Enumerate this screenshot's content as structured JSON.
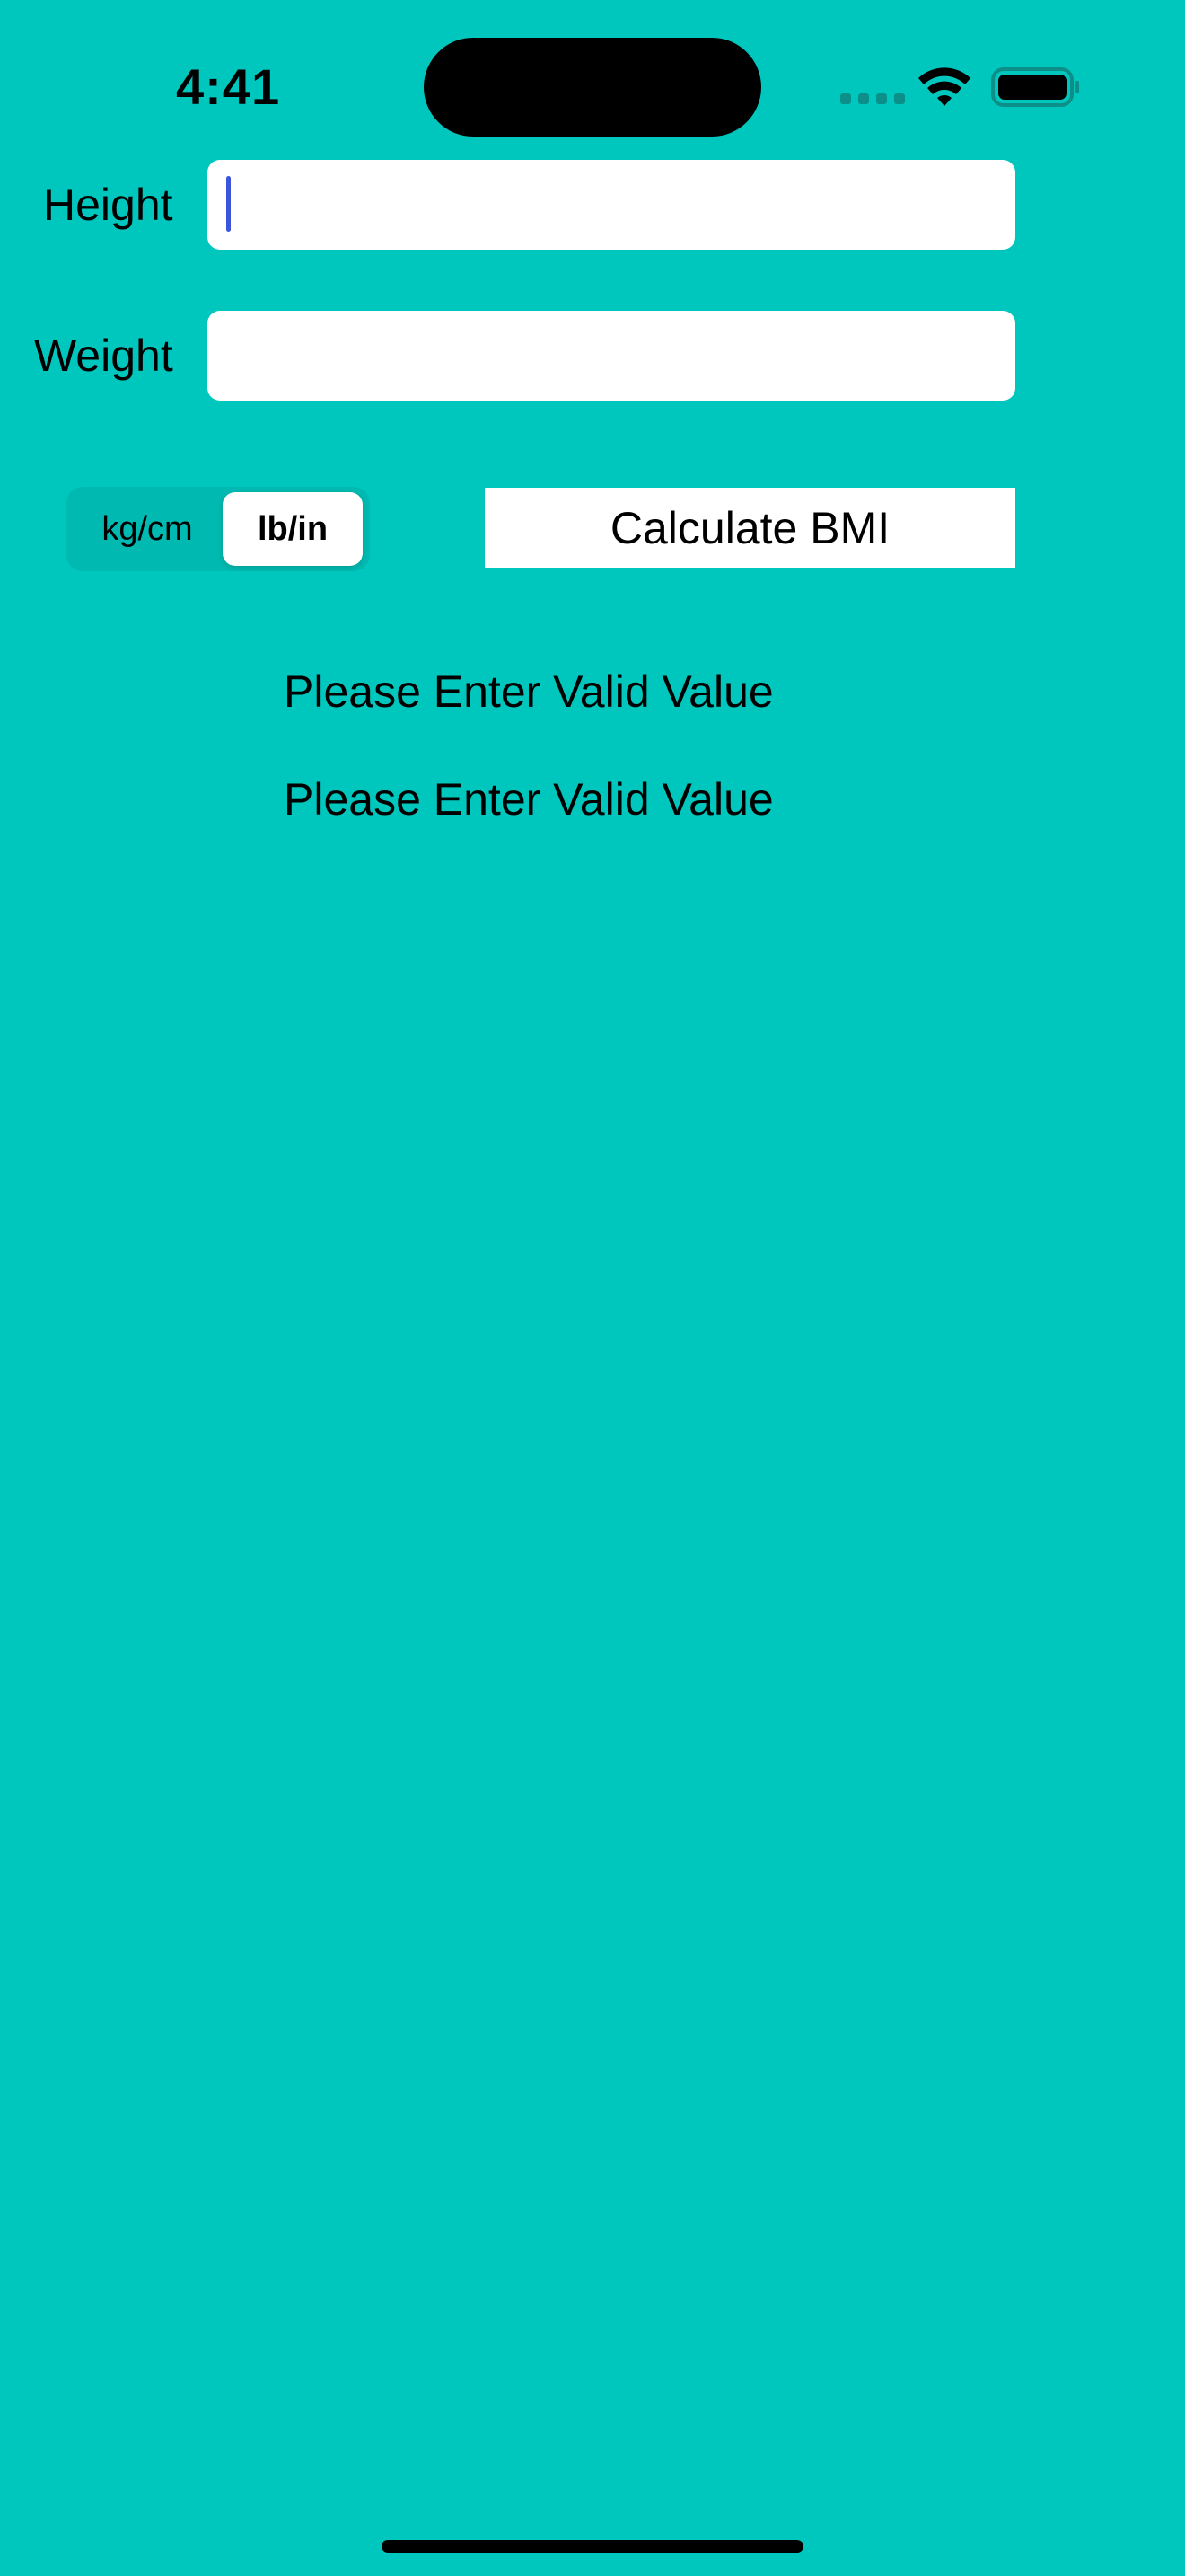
{
  "status_bar": {
    "time": "4:41"
  },
  "form": {
    "height_label": "Height",
    "height_value": "",
    "weight_label": "Weight",
    "weight_value": ""
  },
  "units": {
    "options": [
      "kg/cm",
      "lb/in"
    ],
    "selected": "lb/in"
  },
  "calculate_label": "Calculate BMI",
  "messages": [
    "Please Enter Valid Value",
    "Please Enter Valid Value"
  ],
  "colors": {
    "background": "#00c7be",
    "caret": "#3d55d8"
  }
}
